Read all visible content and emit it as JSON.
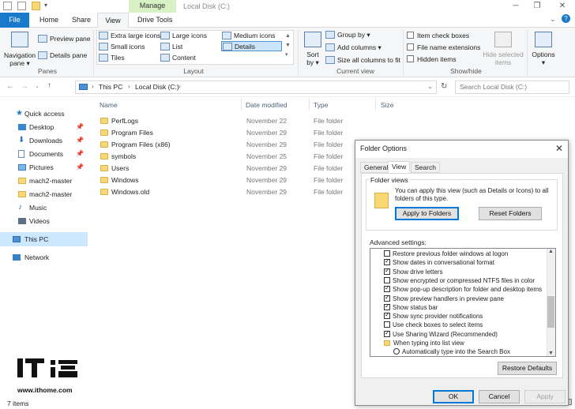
{
  "titlebar": {
    "context_tab": "Manage",
    "title": "Local Disk (C:)",
    "minimize": "─",
    "maximize": "❐",
    "close": "✕"
  },
  "tabs": {
    "file": "File",
    "home": "Home",
    "share": "Share",
    "view": "View",
    "drive_tools": "Drive Tools"
  },
  "ribbon": {
    "panes": {
      "label": "Panes",
      "navigation_pane": "Navigation pane ▾",
      "preview_pane": "Preview pane",
      "details_pane": "Details pane"
    },
    "layout": {
      "label": "Layout",
      "items": [
        "Extra large icons",
        "Large icons",
        "Medium icons",
        "Small icons",
        "List",
        "Details",
        "Tiles",
        "Content"
      ]
    },
    "current_view": {
      "label": "Current view",
      "sort_by": "Sort by ▾",
      "group_by": "Group by ▾",
      "add_columns": "Add columns ▾",
      "size_all_columns": "Size all columns to fit"
    },
    "show_hide": {
      "label": "Show/hide",
      "item_check_boxes": "Item check boxes",
      "file_name_extensions": "File name extensions",
      "hidden_items": "Hidden items",
      "hide_selected": "Hide selected items"
    },
    "options": "Options ▾"
  },
  "address": {
    "path": [
      "This PC",
      "Local Disk (C:)"
    ],
    "search_placeholder": "Search Local Disk (C:)"
  },
  "nav": {
    "quick_access": "Quick access",
    "items": [
      "Desktop",
      "Downloads",
      "Documents",
      "Pictures",
      "mach2-master",
      "mach2-master",
      "Music",
      "Videos"
    ],
    "this_pc": "This PC",
    "network": "Network"
  },
  "columns": {
    "name": "Name",
    "date": "Date modified",
    "type": "Type",
    "size": "Size"
  },
  "files": [
    {
      "name": "PerfLogs",
      "date": "November 22",
      "type": "File folder"
    },
    {
      "name": "Program Files",
      "date": "November 29",
      "type": "File folder"
    },
    {
      "name": "Program Files (x86)",
      "date": "November 29",
      "type": "File folder"
    },
    {
      "name": "symbols",
      "date": "November 25",
      "type": "File folder"
    },
    {
      "name": "Users",
      "date": "November 29",
      "type": "File folder"
    },
    {
      "name": "Windows",
      "date": "November 29",
      "type": "File folder"
    },
    {
      "name": "Windows.old",
      "date": "November 29",
      "type": "File folder"
    }
  ],
  "status": "7 items",
  "watermark": {
    "text": "www.ithome.com"
  },
  "dialog": {
    "title": "Folder Options",
    "tabs": [
      "General",
      "View",
      "Search"
    ],
    "folder_views_label": "Folder views",
    "folder_views_desc": "You can apply this view (such as Details or Icons) to all folders of this type.",
    "apply_to_folders": "Apply to Folders",
    "reset_folders": "Reset Folders",
    "advanced_label": "Advanced settings:",
    "advanced": [
      {
        "text": "Restore previous folder windows at logon",
        "kind": "check",
        "checked": false
      },
      {
        "text": "Show dates in conversational format",
        "kind": "check",
        "checked": true
      },
      {
        "text": "Show drive letters",
        "kind": "check",
        "checked": true
      },
      {
        "text": "Show encrypted or compressed NTFS files in color",
        "kind": "check",
        "checked": false
      },
      {
        "text": "Show pop-up description for folder and desktop items",
        "kind": "check",
        "checked": true
      },
      {
        "text": "Show preview handlers in preview pane",
        "kind": "check",
        "checked": true
      },
      {
        "text": "Show status bar",
        "kind": "check",
        "checked": true
      },
      {
        "text": "Show sync provider notifications",
        "kind": "check",
        "checked": true
      },
      {
        "text": "Use check boxes to select items",
        "kind": "check",
        "checked": false
      },
      {
        "text": "Use Sharing Wizard (Recommended)",
        "kind": "check",
        "checked": true
      },
      {
        "text": "When typing into list view",
        "kind": "folder",
        "checked": false
      },
      {
        "text": "Automatically type into the Search Box",
        "kind": "radio",
        "checked": false
      }
    ],
    "restore_defaults": "Restore Defaults",
    "ok": "OK",
    "cancel": "Cancel",
    "apply": "Apply"
  }
}
